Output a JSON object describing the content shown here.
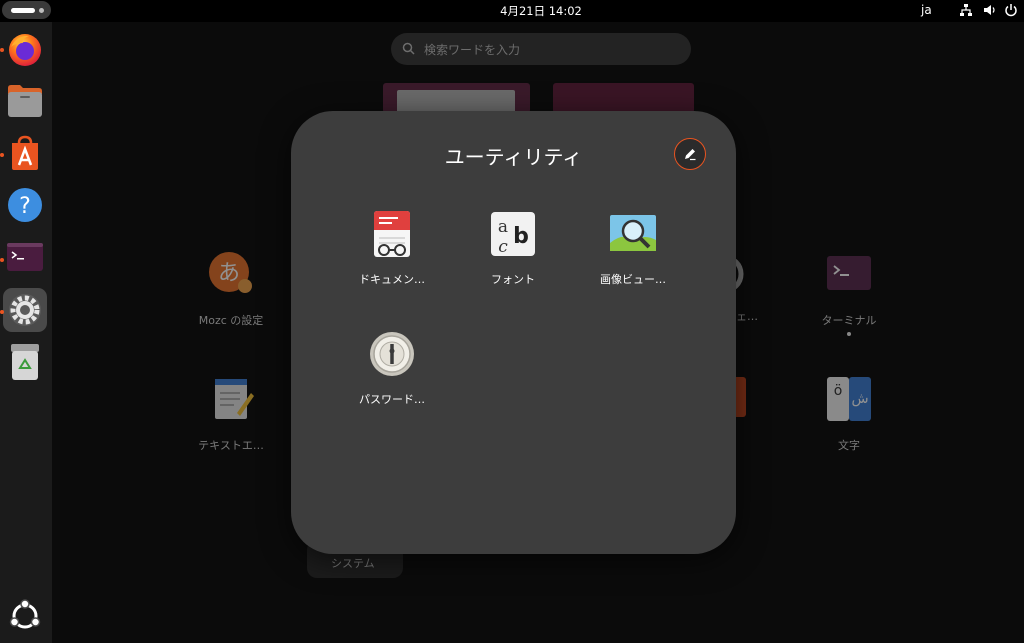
{
  "topbar": {
    "clock": "4月21日  14:02",
    "input_lang": "ja"
  },
  "dock": {
    "items": [
      "firefox",
      "files",
      "app-center",
      "help",
      "terminal",
      "settings",
      "trash",
      "show-apps"
    ]
  },
  "search": {
    "placeholder": "検索ワードを入力"
  },
  "background_apps": {
    "mozc": "Mozc の設定",
    "terminal": "ターミナル",
    "text_editor": "テキストエ…",
    "characters": "文字",
    "partial": "ェ…"
  },
  "system_folder": {
    "label": "システム"
  },
  "folder": {
    "title": "ユーティリティ",
    "apps": [
      {
        "name": "ドキュメン…",
        "icon": "document-viewer-icon"
      },
      {
        "name": "フォント",
        "icon": "fonts-icon"
      },
      {
        "name": "画像ビュー…",
        "icon": "image-viewer-icon"
      },
      {
        "name": "パスワード…",
        "icon": "passwords-icon"
      }
    ]
  },
  "colors": {
    "accent": "#e95420",
    "folder_bg": "#3d3d3d",
    "dock_bg": "#1b1b1b"
  }
}
